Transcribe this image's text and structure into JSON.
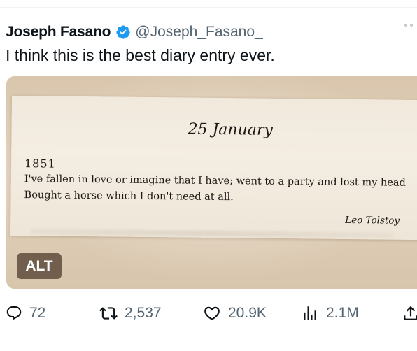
{
  "tweet": {
    "author_name": "Joseph Fasano",
    "handle": "@Joseph_Fasano_",
    "text": "I think this is the best diary entry ever."
  },
  "media": {
    "title": "25 January",
    "year": "1851",
    "line1": "I've fallen in love or imagine that I have; went to a party and lost my head",
    "line2": "Bought a horse which I don't need at all.",
    "signature": "Leo Tolstoy",
    "alt_label": "ALT"
  },
  "actions": {
    "replies": "72",
    "retweets": "2,537",
    "likes": "20.9K",
    "views": "2.1M"
  },
  "colors": {
    "verified": "#1d9bf0",
    "secondary_text": "#536471",
    "primary_text": "#0f1419"
  }
}
